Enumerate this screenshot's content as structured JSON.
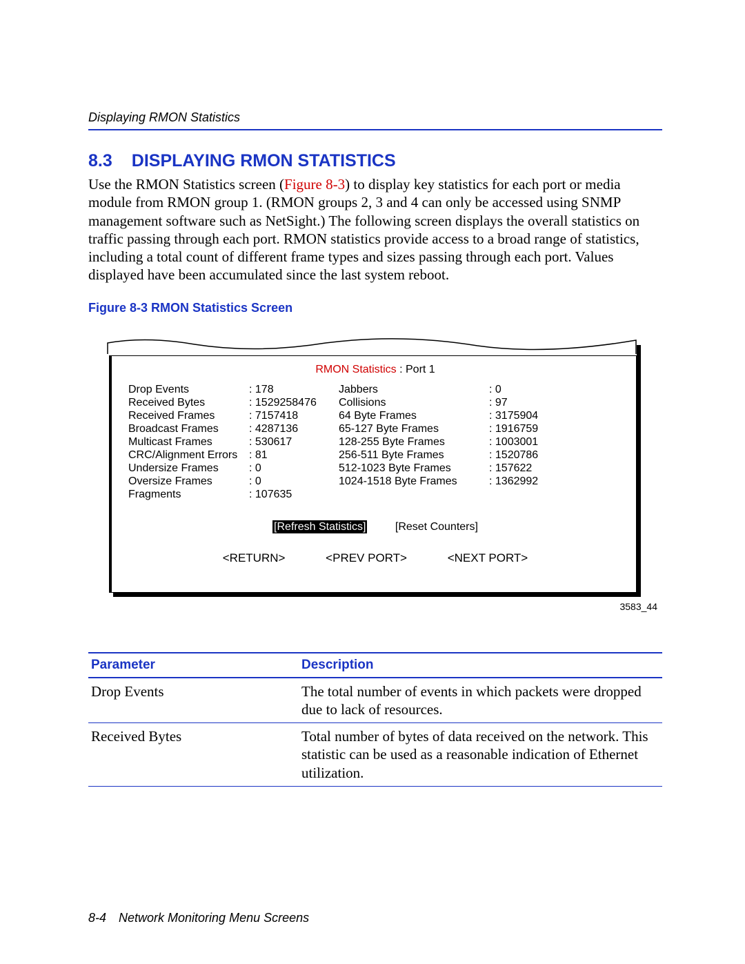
{
  "header": {
    "running": "Displaying RMON Statistics"
  },
  "section": {
    "number": "8.3",
    "title": "DISPLAYING RMON STATISTICS",
    "body_pre": "Use the RMON Statistics screen (",
    "body_ref": "Figure 8-3",
    "body_post": ") to display key statistics for each port or media module from RMON group 1. (RMON groups 2, 3 and 4 can only be accessed using SNMP management software such as NetSight.) The following screen displays the overall statistics on traffic passing through each port. RMON statistics provide access to a broad range of statistics, including a total count of different frame types and sizes passing through each port. Values displayed have been accumulated since the last system reboot."
  },
  "figure": {
    "caption": "Figure 8-3   RMON Statistics Screen",
    "title_red": "RMON Statistics",
    "title_rest": " : Port   1",
    "left": [
      {
        "label": "Drop Events",
        "value": "178"
      },
      {
        "label": "Received Bytes",
        "value": "1529258476"
      },
      {
        "label": "Received Frames",
        "value": "7157418"
      },
      {
        "label": "Broadcast Frames",
        "value": "4287136"
      },
      {
        "label": "Multicast Frames",
        "value": "530617"
      },
      {
        "label": "CRC/Alignment Errors",
        "value": "81"
      },
      {
        "label": "Undersize Frames",
        "value": "0"
      },
      {
        "label": "Oversize Frames",
        "value": "0"
      },
      {
        "label": "Fragments",
        "value": "107635"
      }
    ],
    "right": [
      {
        "label": "Jabbers",
        "value": "0"
      },
      {
        "label": "Collisions",
        "value": "97"
      },
      {
        "label": "64 Byte Frames",
        "value": "3175904"
      },
      {
        "label": "65-127 Byte Frames",
        "value": "1916759"
      },
      {
        "label": "128-255 Byte Frames",
        "value": "1003001"
      },
      {
        "label": "256-511 Byte Frames",
        "value": "1520786"
      },
      {
        "label": "512-1023 Byte Frames",
        "value": "157622"
      },
      {
        "label": "1024-1518 Byte Frames",
        "value": "1362992"
      }
    ],
    "buttons": {
      "refresh": "[Refresh Statistics]",
      "reset": "[Reset Counters]"
    },
    "nav": {
      "return": "<RETURN>",
      "prev": "<PREV PORT>",
      "next": "<NEXT PORT>"
    },
    "id": "3583_44"
  },
  "table": {
    "head": {
      "param": "Parameter",
      "desc": "Description"
    },
    "rows": [
      {
        "param": "Drop Events",
        "desc": "The total number of events in which packets were dropped due to lack of resources."
      },
      {
        "param": "Received Bytes",
        "desc": "Total number of bytes of data received on the network. This statistic can be used as a reasonable indication of Ethernet utilization."
      }
    ]
  },
  "footer": {
    "page": "8-4",
    "title": "Network Monitoring Menu Screens"
  }
}
